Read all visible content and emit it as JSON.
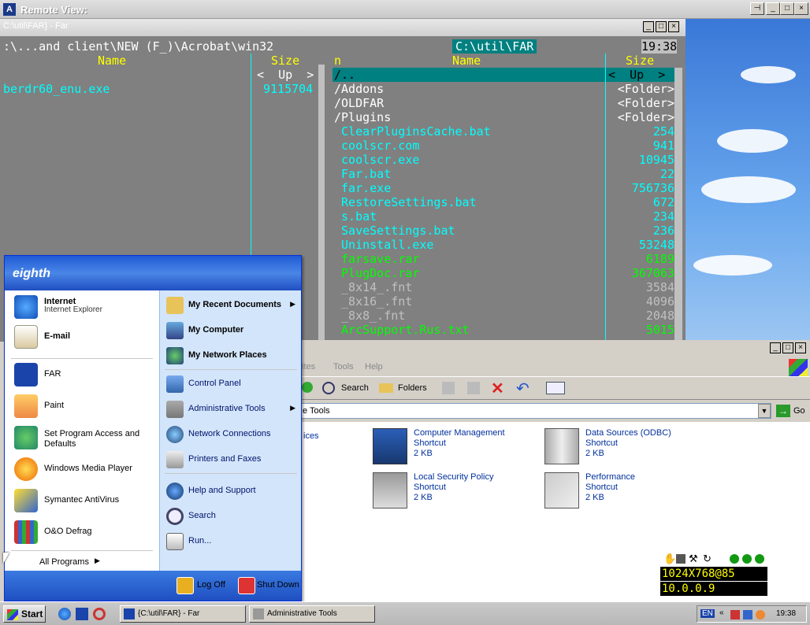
{
  "remote_view": {
    "title": "Remote View:"
  },
  "far": {
    "window_title": "C:\\util\\FAR} - Far",
    "clock": "19:38",
    "left_panel": {
      "path": ":\\...and client\\NEW (F_)\\Acrobat\\win32",
      "col_name": "Name",
      "col_size": "Size",
      "up": "<  Up  >",
      "files": [
        {
          "name": "berdr60_enu.exe",
          "size": "9115704"
        }
      ]
    },
    "right_panel": {
      "path": "C:\\util\\FAR",
      "col_n": "n",
      "col_name": "Name",
      "col_size": "Size",
      "up_name": "/..",
      "up_size": "<  Up  >",
      "files": [
        {
          "name": "/Addons",
          "size": "<Folder>",
          "kind": "white"
        },
        {
          "name": "/OLDFAR",
          "size": "<Folder>",
          "kind": "white"
        },
        {
          "name": "/Plugins",
          "size": "<Folder>",
          "kind": "white"
        },
        {
          "name": " ClearPluginsCache.bat",
          "size": "254",
          "kind": "cyan"
        },
        {
          "name": " coolscr.com",
          "size": "941",
          "kind": "cyan"
        },
        {
          "name": " coolscr.exe",
          "size": "10945",
          "kind": "cyan"
        },
        {
          "name": " Far.bat",
          "size": "22",
          "kind": "cyan"
        },
        {
          "name": " far.exe",
          "size": "756736",
          "kind": "cyan"
        },
        {
          "name": " RestoreSettings.bat",
          "size": "672",
          "kind": "cyan"
        },
        {
          "name": " s.bat",
          "size": "234",
          "kind": "cyan"
        },
        {
          "name": " SaveSettings.bat",
          "size": "236",
          "kind": "cyan"
        },
        {
          "name": " Uninstall.exe",
          "size": "53248",
          "kind": "cyan"
        },
        {
          "name": " farsave.rar",
          "size": "6189",
          "kind": "green"
        },
        {
          "name": " PlugDoc.rar",
          "size": "367063",
          "kind": "green"
        },
        {
          "name": " _8x14_.fnt",
          "size": "3584",
          "kind": "gray"
        },
        {
          "name": " _8x16_.fnt",
          "size": "4096",
          "kind": "gray"
        },
        {
          "name": " _8x8_.fnt",
          "size": "2048",
          "kind": "gray"
        },
        {
          "name": " ArcSupport.Rus.txt",
          "size": "5015",
          "kind": "green"
        }
      ]
    }
  },
  "explorer": {
    "menu": [
      "ites",
      "Tools",
      "Help"
    ],
    "toolbar": {
      "search": "Search",
      "folders": "Folders"
    },
    "address": "e Tools",
    "go": "Go",
    "partial_item": "ices",
    "items": [
      {
        "name": "Computer Management",
        "type": "Shortcut",
        "size": "2 KB"
      },
      {
        "name": "Data Sources (ODBC)",
        "type": "Shortcut",
        "size": "2 KB"
      },
      {
        "name": "Local Security Policy",
        "type": "Shortcut",
        "size": "2 KB"
      },
      {
        "name": "Performance",
        "type": "Shortcut",
        "size": "2 KB"
      }
    ]
  },
  "start_menu": {
    "user": "eighth",
    "pinned": [
      {
        "label": "Internet",
        "sub": "Internet Explorer"
      },
      {
        "label": "E-mail"
      }
    ],
    "recent": [
      "FAR",
      "Paint",
      "Set Program Access and Defaults",
      "Windows Media Player",
      "Symantec AntiVirus",
      "O&O Defrag"
    ],
    "all_programs": "All Programs",
    "right": [
      "My Recent Documents",
      "My Computer",
      "My Network Places",
      "Control Panel",
      "Administrative Tools",
      "Network Connections",
      "Printers and Faxes",
      "Help and Support",
      "Search",
      "Run..."
    ],
    "log_off": "Log Off",
    "shut_down": "Shut Down"
  },
  "taskbar": {
    "start": "Start",
    "tasks": [
      "{C:\\util\\FAR} - Far",
      "Administrative Tools"
    ],
    "lang": "EN",
    "clock": "19:38"
  },
  "overlay": {
    "resolution": "1024X768@85",
    "ip": "10.0.0.9"
  }
}
